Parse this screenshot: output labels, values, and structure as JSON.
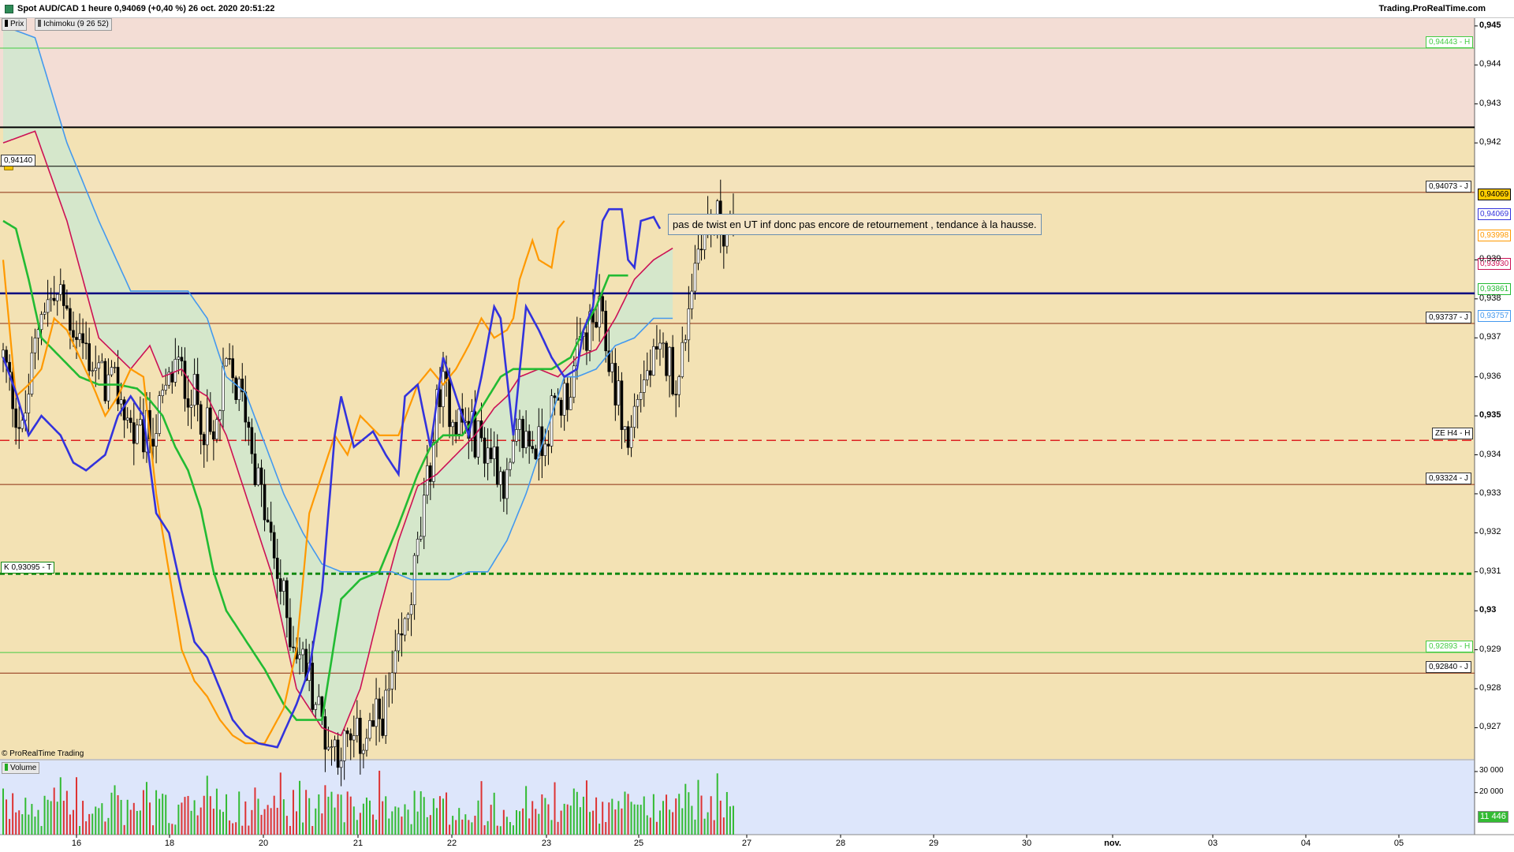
{
  "header": {
    "title": "Spot AUD/CAD 1 heure 0,94069 (+0,40 %) 26 oct. 2020 20:51:22",
    "brand": "Trading.ProRealTime.com"
  },
  "legend": {
    "price": "Prix",
    "ichimoku": "Ichimoku (9 26 52)",
    "volume": "Volume"
  },
  "copyright": "© ProRealTime Trading",
  "annotation": "pas de twist en UT inf donc pas encore de retournement , tendance à la hausse.",
  "colors": {
    "tenkan": "#3333dd",
    "kijun": "#22bb33",
    "chikou": "#ff9900",
    "ssa": "#cc1155",
    "ssb": "#4499ee",
    "cloud": "#cfe8cf",
    "background": "#f3e2b4",
    "upper_band": "#f3ddd5",
    "up_candle": "#ffffff",
    "down_candle": "#000000",
    "volume_up": "#33bb33",
    "volume_down": "#dd3333",
    "volume_bg": "#dde6fb"
  },
  "levels": [
    {
      "label": "0,94443 - H",
      "price": 0.94443,
      "color": "#44cc44",
      "style": "thin-green",
      "labelled": true
    },
    {
      "label": "",
      "price": 0.9424,
      "color": "#000000",
      "style": "thick-black",
      "labelled": false
    },
    {
      "label": "0,94140",
      "price": 0.9414,
      "color": "#000000",
      "style": "thin-black",
      "labelled": true
    },
    {
      "label": "0,94073 - J",
      "price": 0.94073,
      "color": "#8b2d10",
      "style": "brown",
      "labelled": true
    },
    {
      "label": "",
      "price": 0.93814,
      "color": "#000080",
      "style": "thick-navy",
      "labelled": false
    },
    {
      "label": "0,93737 - J",
      "price": 0.93737,
      "color": "#8b2d10",
      "style": "brown",
      "labelled": true
    },
    {
      "label": "ZE H4 - H",
      "price": 0.93437,
      "color": "#dd2222",
      "style": "red-dashed",
      "labelled": true
    },
    {
      "label": "0,93324 - J",
      "price": 0.93324,
      "color": "#8b2d10",
      "style": "brown",
      "labelled": true
    },
    {
      "label": "K 0,93095 - T",
      "price": 0.93095,
      "color": "#118811",
      "style": "green-dashed",
      "labelled": true
    },
    {
      "label": "0,92893 - H",
      "price": 0.92893,
      "color": "#44cc44",
      "style": "thin-green",
      "labelled": true
    },
    {
      "label": "0,92840 - J",
      "price": 0.9284,
      "color": "#8b2d10",
      "style": "brown",
      "labelled": true
    }
  ],
  "price_tags": [
    {
      "label": "0,94069",
      "price": 0.94069,
      "bg": "#ffcc00",
      "fg": "#000000"
    },
    {
      "label": "0,94069",
      "price": 0.94018,
      "bg": "#ffffff",
      "fg": "#3333dd"
    },
    {
      "label": "0,93998",
      "price": 0.93963,
      "bg": "#ffffff",
      "fg": "#ff9900"
    },
    {
      "label": "0,93930",
      "price": 0.9389,
      "bg": "#ffffff",
      "fg": "#cc1155"
    },
    {
      "label": "0,93861",
      "price": 0.93826,
      "bg": "#ffffff",
      "fg": "#22bb33"
    },
    {
      "label": "0,93757",
      "price": 0.93757,
      "bg": "#ffffff",
      "fg": "#4499ee"
    }
  ],
  "volume_tag": {
    "label": "11 446",
    "value": 11446
  },
  "chart_data": {
    "type": "candlestick",
    "title": "Spot AUD/CAD 1 heure",
    "ylim": [
      0.9262,
      0.9452
    ],
    "y_ticks": [
      {
        "value": 0.945,
        "label": "0,945",
        "major": true
      },
      {
        "value": 0.944,
        "label": "0,944",
        "major": false
      },
      {
        "value": 0.943,
        "label": "0,943",
        "major": false
      },
      {
        "value": 0.942,
        "label": "0,942",
        "major": false
      },
      {
        "value": 0.939,
        "label": "0,939",
        "major": false
      },
      {
        "value": 0.938,
        "label": "0,938",
        "major": false
      },
      {
        "value": 0.937,
        "label": "0,937",
        "major": false
      },
      {
        "value": 0.936,
        "label": "0,936",
        "major": false
      },
      {
        "value": 0.935,
        "label": "0,935",
        "major": true
      },
      {
        "value": 0.934,
        "label": "0,934",
        "major": false
      },
      {
        "value": 0.933,
        "label": "0,933",
        "major": false
      },
      {
        "value": 0.932,
        "label": "0,932",
        "major": false
      },
      {
        "value": 0.931,
        "label": "0,931",
        "major": false
      },
      {
        "value": 0.93,
        "label": "0,93",
        "major": true
      },
      {
        "value": 0.929,
        "label": "0,929",
        "major": false
      },
      {
        "value": 0.928,
        "label": "0,928",
        "major": false
      },
      {
        "value": 0.927,
        "label": "0,927",
        "major": false
      }
    ],
    "x_ticks": [
      {
        "label": "16",
        "bold": false
      },
      {
        "label": "18",
        "bold": false
      },
      {
        "label": "20",
        "bold": false
      },
      {
        "label": "21",
        "bold": false
      },
      {
        "label": "22",
        "bold": false
      },
      {
        "label": "23",
        "bold": false
      },
      {
        "label": "25",
        "bold": false
      },
      {
        "label": "27",
        "bold": false
      },
      {
        "label": "28",
        "bold": false
      },
      {
        "label": "29",
        "bold": false
      },
      {
        "label": "30",
        "bold": false
      },
      {
        "label": "nov.",
        "bold": true
      },
      {
        "label": "03",
        "bold": false
      },
      {
        "label": "04",
        "bold": false
      },
      {
        "label": "05",
        "bold": false
      }
    ],
    "volume_ticks": [
      {
        "value": 30000,
        "label": "30 000"
      },
      {
        "value": 20000,
        "label": "20 000"
      }
    ],
    "price_anchors": [
      [
        0,
        0.9365
      ],
      [
        6,
        0.9345
      ],
      [
        12,
        0.9379
      ],
      [
        18,
        0.938
      ],
      [
        24,
        0.937
      ],
      [
        30,
        0.936
      ],
      [
        36,
        0.9356
      ],
      [
        42,
        0.9343
      ],
      [
        48,
        0.9348
      ],
      [
        54,
        0.9363
      ],
      [
        60,
        0.9355
      ],
      [
        66,
        0.9342
      ],
      [
        70,
        0.9362
      ],
      [
        76,
        0.9352
      ],
      [
        80,
        0.9333
      ],
      [
        85,
        0.9313
      ],
      [
        90,
        0.9295
      ],
      [
        96,
        0.9283
      ],
      [
        102,
        0.9266
      ],
      [
        108,
        0.9265
      ],
      [
        114,
        0.9268
      ],
      [
        120,
        0.9275
      ],
      [
        126,
        0.9295
      ],
      [
        132,
        0.9325
      ],
      [
        137,
        0.9358
      ],
      [
        142,
        0.935
      ],
      [
        148,
        0.9345
      ],
      [
        154,
        0.934
      ],
      [
        158,
        0.9332
      ],
      [
        162,
        0.9345
      ],
      [
        168,
        0.9342
      ],
      [
        172,
        0.935
      ],
      [
        178,
        0.9358
      ],
      [
        182,
        0.937
      ],
      [
        187,
        0.9375
      ],
      [
        192,
        0.9358
      ],
      [
        196,
        0.9342
      ],
      [
        199,
        0.9356
      ],
      [
        203,
        0.9362
      ],
      [
        208,
        0.9365
      ],
      [
        212,
        0.9358
      ],
      [
        215,
        0.938
      ],
      [
        219,
        0.9398
      ],
      [
        224,
        0.94
      ],
      [
        230,
        0.9395
      ]
    ],
    "tenkan_anchors": [
      [
        0,
        0.9365
      ],
      [
        4,
        0.9356
      ],
      [
        8,
        0.9345
      ],
      [
        12,
        0.935
      ],
      [
        18,
        0.9345
      ],
      [
        22,
        0.9338
      ],
      [
        26,
        0.9336
      ],
      [
        32,
        0.934
      ],
      [
        36,
        0.935
      ],
      [
        40,
        0.9355
      ],
      [
        44,
        0.935
      ],
      [
        48,
        0.9325
      ],
      [
        52,
        0.932
      ],
      [
        56,
        0.9305
      ],
      [
        60,
        0.9292
      ],
      [
        64,
        0.9288
      ],
      [
        68,
        0.928
      ],
      [
        72,
        0.9272
      ],
      [
        76,
        0.9268
      ],
      [
        80,
        0.9266
      ],
      [
        86,
        0.9265
      ],
      [
        92,
        0.9276
      ],
      [
        96,
        0.9285
      ],
      [
        100,
        0.9305
      ],
      [
        104,
        0.9345
      ],
      [
        106,
        0.9355
      ],
      [
        110,
        0.9342
      ],
      [
        116,
        0.9346
      ],
      [
        120,
        0.934
      ],
      [
        124,
        0.9335
      ],
      [
        126,
        0.9355
      ],
      [
        130,
        0.9358
      ],
      [
        134,
        0.9342
      ],
      [
        138,
        0.9365
      ],
      [
        142,
        0.9355
      ],
      [
        146,
        0.9345
      ],
      [
        150,
        0.936
      ],
      [
        154,
        0.9378
      ],
      [
        156,
        0.9375
      ],
      [
        160,
        0.9345
      ],
      [
        164,
        0.9378
      ],
      [
        168,
        0.9372
      ],
      [
        172,
        0.9365
      ],
      [
        176,
        0.936
      ],
      [
        180,
        0.9362
      ],
      [
        182,
        0.9372
      ],
      [
        185,
        0.9378
      ],
      [
        188,
        0.94
      ],
      [
        190,
        0.9403
      ],
      [
        194,
        0.9403
      ],
      [
        196,
        0.939
      ],
      [
        198,
        0.9388
      ],
      [
        200,
        0.94
      ],
      [
        204,
        0.9401
      ],
      [
        206,
        0.9398
      ]
    ],
    "kijun_anchors": [
      [
        0,
        0.94
      ],
      [
        4,
        0.9398
      ],
      [
        8,
        0.9385
      ],
      [
        12,
        0.937
      ],
      [
        18,
        0.9365
      ],
      [
        24,
        0.936
      ],
      [
        30,
        0.9358
      ],
      [
        36,
        0.9358
      ],
      [
        42,
        0.9357
      ],
      [
        46,
        0.9354
      ],
      [
        50,
        0.935
      ],
      [
        54,
        0.9342
      ],
      [
        58,
        0.9336
      ],
      [
        62,
        0.9326
      ],
      [
        66,
        0.931
      ],
      [
        70,
        0.93
      ],
      [
        74,
        0.9295
      ],
      [
        78,
        0.929
      ],
      [
        82,
        0.9285
      ],
      [
        88,
        0.9276
      ],
      [
        92,
        0.9272
      ],
      [
        100,
        0.9272
      ],
      [
        106,
        0.9303
      ],
      [
        112,
        0.9308
      ],
      [
        118,
        0.931
      ],
      [
        124,
        0.9322
      ],
      [
        130,
        0.9335
      ],
      [
        134,
        0.9342
      ],
      [
        138,
        0.9345
      ],
      [
        144,
        0.9345
      ],
      [
        150,
        0.9352
      ],
      [
        156,
        0.936
      ],
      [
        160,
        0.9362
      ],
      [
        166,
        0.9362
      ],
      [
        172,
        0.9362
      ],
      [
        178,
        0.9365
      ],
      [
        182,
        0.9372
      ],
      [
        186,
        0.9378
      ],
      [
        190,
        0.9386
      ],
      [
        196,
        0.9386
      ]
    ],
    "chikou_anchors": [
      [
        0,
        0.939
      ],
      [
        4,
        0.9355
      ],
      [
        8,
        0.9358
      ],
      [
        12,
        0.9362
      ],
      [
        16,
        0.9375
      ],
      [
        20,
        0.9372
      ],
      [
        24,
        0.9365
      ],
      [
        28,
        0.9358
      ],
      [
        32,
        0.935
      ],
      [
        36,
        0.9355
      ],
      [
        40,
        0.9362
      ],
      [
        44,
        0.936
      ],
      [
        48,
        0.933
      ],
      [
        52,
        0.931
      ],
      [
        56,
        0.929
      ],
      [
        60,
        0.9282
      ],
      [
        64,
        0.9278
      ],
      [
        68,
        0.9272
      ],
      [
        72,
        0.9268
      ],
      [
        76,
        0.9266
      ],
      [
        82,
        0.9266
      ],
      [
        88,
        0.9275
      ],
      [
        92,
        0.929
      ],
      [
        96,
        0.9325
      ],
      [
        100,
        0.9335
      ],
      [
        104,
        0.9345
      ],
      [
        108,
        0.934
      ],
      [
        112,
        0.935
      ],
      [
        118,
        0.9345
      ],
      [
        124,
        0.9345
      ],
      [
        130,
        0.9358
      ],
      [
        134,
        0.9362
      ],
      [
        138,
        0.9358
      ],
      [
        142,
        0.9362
      ],
      [
        146,
        0.9368
      ],
      [
        150,
        0.9375
      ],
      [
        154,
        0.937
      ],
      [
        158,
        0.9372
      ],
      [
        160,
        0.9375
      ],
      [
        162,
        0.9385
      ],
      [
        166,
        0.9395
      ],
      [
        168,
        0.939
      ],
      [
        172,
        0.9388
      ],
      [
        174,
        0.9398
      ],
      [
        176,
        0.94
      ]
    ],
    "ssa_anchors": [
      [
        0,
        0.942
      ],
      [
        10,
        0.9423
      ],
      [
        20,
        0.94
      ],
      [
        30,
        0.937
      ],
      [
        40,
        0.9362
      ],
      [
        46,
        0.9368
      ],
      [
        50,
        0.936
      ],
      [
        56,
        0.9362
      ],
      [
        60,
        0.9357
      ],
      [
        64,
        0.9355
      ],
      [
        70,
        0.9345
      ],
      [
        76,
        0.933
      ],
      [
        84,
        0.931
      ],
      [
        92,
        0.928
      ],
      [
        100,
        0.927
      ],
      [
        106,
        0.9268
      ],
      [
        112,
        0.928
      ],
      [
        118,
        0.93
      ],
      [
        124,
        0.9318
      ],
      [
        130,
        0.9332
      ],
      [
        136,
        0.9335
      ],
      [
        142,
        0.934
      ],
      [
        148,
        0.9345
      ],
      [
        154,
        0.9352
      ],
      [
        158,
        0.9355
      ],
      [
        162,
        0.936
      ],
      [
        168,
        0.9362
      ],
      [
        174,
        0.936
      ],
      [
        180,
        0.9365
      ],
      [
        186,
        0.9367
      ],
      [
        192,
        0.9375
      ],
      [
        198,
        0.9385
      ],
      [
        204,
        0.939
      ],
      [
        210,
        0.9393
      ]
    ],
    "ssb_anchors": [
      [
        0,
        0.945
      ],
      [
        10,
        0.9447
      ],
      [
        20,
        0.942
      ],
      [
        30,
        0.94
      ],
      [
        40,
        0.9382
      ],
      [
        50,
        0.9382
      ],
      [
        58,
        0.9382
      ],
      [
        64,
        0.9375
      ],
      [
        70,
        0.936
      ],
      [
        76,
        0.9356
      ],
      [
        82,
        0.9343
      ],
      [
        88,
        0.933
      ],
      [
        94,
        0.932
      ],
      [
        100,
        0.9312
      ],
      [
        106,
        0.931
      ],
      [
        112,
        0.931
      ],
      [
        118,
        0.931
      ],
      [
        122,
        0.931
      ],
      [
        128,
        0.9308
      ],
      [
        134,
        0.9308
      ],
      [
        140,
        0.9308
      ],
      [
        146,
        0.931
      ],
      [
        152,
        0.931
      ],
      [
        158,
        0.9318
      ],
      [
        164,
        0.933
      ],
      [
        170,
        0.9345
      ],
      [
        176,
        0.936
      ],
      [
        180,
        0.936
      ],
      [
        186,
        0.9362
      ],
      [
        192,
        0.9368
      ],
      [
        198,
        0.937
      ],
      [
        204,
        0.9375
      ],
      [
        210,
        0.9375
      ]
    ],
    "candle_count": 230,
    "volume_range": [
      0,
      33000
    ]
  }
}
